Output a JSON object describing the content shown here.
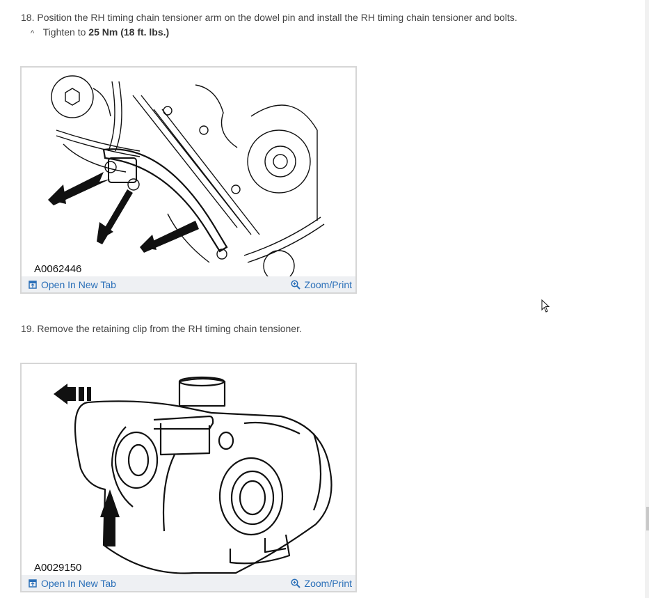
{
  "steps": [
    {
      "number": "18.",
      "text": "Position the RH timing chain tensioner arm on the dowel pin and install the RH timing chain tensioner and bolts.",
      "note": {
        "marker": "^",
        "prefix": "Tighten to",
        "value": "25 Nm (18 ft. lbs.)"
      },
      "figure": {
        "id": "A0062446",
        "open_label": "Open In New Tab",
        "zoom_label": "Zoom/Print"
      }
    },
    {
      "number": "19.",
      "text": "Remove the retaining clip from the RH timing chain tensioner.",
      "figure": {
        "id": "A0029150",
        "open_label": "Open In New Tab",
        "zoom_label": "Zoom/Print"
      }
    }
  ],
  "colors": {
    "link": "#2a6fb8",
    "figure_bar": "#eef0f3",
    "figure_border": "#d6d6d6",
    "text": "#444444"
  },
  "icons": {
    "open": "open-new-tab-icon",
    "zoom": "zoom-in-icon"
  }
}
